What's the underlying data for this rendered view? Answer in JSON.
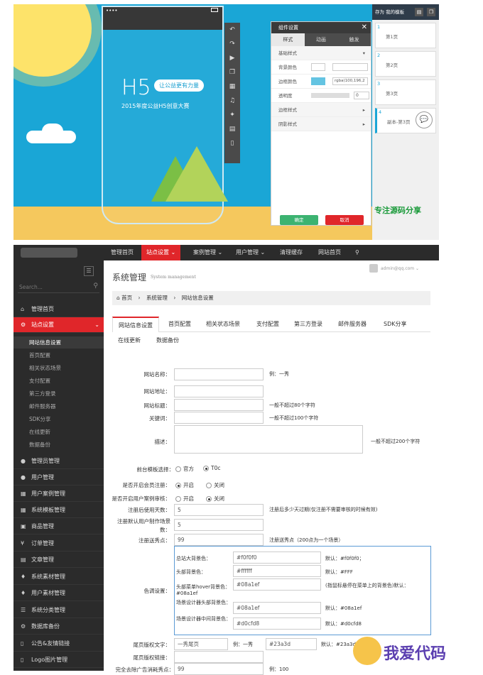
{
  "editor": {
    "h5_title": "H5",
    "h5_pill": "让公益更有力量",
    "h5_sub": "2015年度公益H5创意大赛",
    "panel_title": "组件设置",
    "tabs": [
      "样式",
      "动画",
      "触发"
    ],
    "sections": {
      "basic": "基础样式",
      "bg_color": "背景颜色",
      "border_color": "边框颜色",
      "border_value": "rgba(100,196,2",
      "opacity": "透明度",
      "opacity_value": "0",
      "border_style": "边框样式",
      "shadow_style": "阴影样式"
    },
    "confirm": "确定",
    "cancel": "取消",
    "pages_head": "存为 我的模板",
    "pages": [
      {
        "num": "1",
        "label": "第1页"
      },
      {
        "num": "2",
        "label": "第2页"
      },
      {
        "num": "3",
        "label": "第3页"
      },
      {
        "num": "4",
        "label": "副本-第3页"
      }
    ],
    "watermark": "专注源码分享"
  },
  "topnav": [
    "管理首页",
    "站点设置 ⌄",
    "案例管理 ⌄",
    "用户管理 ⌄",
    "清理缓存",
    "网站首页",
    "⚲"
  ],
  "sidebar": {
    "search_placeholder": "Search...",
    "items": [
      {
        "label": "管理首页",
        "icon": "home-icon",
        "glyph": "⌂"
      },
      {
        "label": "站点设置",
        "icon": "cogs-icon",
        "glyph": "⚙"
      }
    ],
    "subs": [
      "网站信息设置",
      "首页配置",
      "相关状态场景",
      "支付配置",
      "第三方登录",
      "邮件服务器",
      "SDK分享",
      "在线更新",
      "数据备份"
    ],
    "items2": [
      {
        "label": "管理员管理",
        "icon": "user-icon",
        "glyph": "●"
      },
      {
        "label": "用户管理",
        "icon": "user-icon",
        "glyph": "●"
      },
      {
        "label": "用户案例管理",
        "icon": "table-icon",
        "glyph": "▦"
      },
      {
        "label": "系统模板管理",
        "icon": "table-icon",
        "glyph": "▦"
      },
      {
        "label": "商品管理",
        "icon": "box-icon",
        "glyph": "▣"
      },
      {
        "label": "订单管理",
        "icon": "yen-icon",
        "glyph": "¥"
      },
      {
        "label": "文章管理",
        "icon": "file-icon",
        "glyph": "▤"
      },
      {
        "label": "系统素材管理",
        "icon": "gift-icon",
        "glyph": "♦"
      },
      {
        "label": "用户素材管理",
        "icon": "gift-icon",
        "glyph": "♦"
      },
      {
        "label": "系统分类管理",
        "icon": "list-icon",
        "glyph": "☰"
      },
      {
        "label": "数据库备份",
        "icon": "cogs-icon",
        "glyph": "⚙"
      },
      {
        "label": "公告&友情链接",
        "icon": "bookmark-icon",
        "glyph": "▯"
      },
      {
        "label": "Logo图片管理",
        "icon": "bookmark-icon",
        "glyph": "▯"
      }
    ]
  },
  "header": {
    "title": "系统管理",
    "subtitle": "System management",
    "user": "admin@qq.com ⌄"
  },
  "breadcrumb": {
    "home": "首页",
    "sep": "›",
    "b1": "系统管理",
    "b2": "网站信息设置"
  },
  "tabs": [
    "网站信息设置",
    "首页配置",
    "相关状态场景",
    "支付配置",
    "第三方登录",
    "邮件服务器",
    "SDK分享",
    "在线更新",
    "数据备份"
  ],
  "form": {
    "site_name": {
      "label": "网站名称：",
      "hint": "例：一秀"
    },
    "site_url": {
      "label": "网站地址："
    },
    "site_title": {
      "label": "网站标题：",
      "hint": "一般不超过80个字符"
    },
    "keywords": {
      "label": "关键词：",
      "hint": "一般不超过100个字符"
    },
    "desc": {
      "label": "描述：",
      "hint": "一般不超过200个字符"
    },
    "template": {
      "label": "前台模板选择：",
      "opt1": "官方",
      "opt2": "T0c"
    },
    "member_reg": {
      "label": "是否开启会员注册：",
      "opt1": "开启",
      "opt2": "关闭"
    },
    "case_review": {
      "label": "是否开启用户案例审核：",
      "opt1": "开启",
      "opt2": "关闭"
    },
    "trial_days": {
      "label": "注册后使用天数：",
      "value": "5",
      "hint": "注册后多少天过期(仅注册不需要审核的时候有效)"
    },
    "default_scenes": {
      "label": "注册默认用户制作场景数：",
      "value": "5"
    },
    "reg_points": {
      "label": "注册送秀点：",
      "value": "99",
      "hint": "注册送秀点（200点为一个场景）"
    },
    "color": {
      "label": "色调设置：",
      "rows": [
        {
          "label": "总站大背景色：",
          "value": "#f0f0f0",
          "hint": "默认：#f0f0f0；"
        },
        {
          "label": "头部背景色：",
          "value": "#ffffff",
          "hint": "默认：#FFF"
        },
        {
          "label": "头部菜单hover背景色：",
          "label2": "#08a1ef",
          "value": "#08a1ef",
          "hint": "(指鼠标悬停在菜单上的背景色)默认："
        },
        {
          "label": "场景设计器头部背景色：",
          "value": "#08a1ef",
          "hint": "默认：#08a1ef"
        },
        {
          "label": "场景设计器中间背景色：",
          "value": "#d0cfd8",
          "hint": "默认：#d0cfd8"
        }
      ]
    },
    "footer_text": {
      "label": "尾页版权文字：",
      "value": "一秀尾页",
      "hint": "例：一秀",
      "value2": "#23a3d",
      "hint2": "默认：#23a3d"
    },
    "footer_link": {
      "label": "尾页版权链接："
    },
    "remove_ad": {
      "label": "完全去除广告消耗秀点：",
      "value": "99",
      "hint": "例：100"
    }
  },
  "brand_watermark": "我爱代码"
}
